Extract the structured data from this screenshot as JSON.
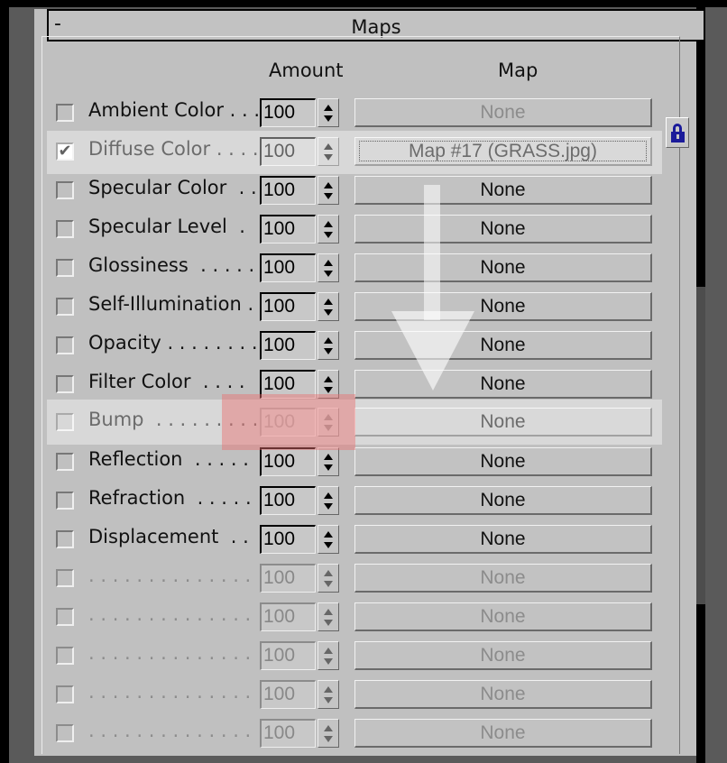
{
  "rollout": {
    "title": "Maps",
    "collapse_symbol": "-"
  },
  "columns": {
    "amount": "Amount",
    "map": "Map"
  },
  "rows": [
    {
      "label": "Ambient Color . . .",
      "checked": false,
      "enabled": true,
      "amount": "100",
      "map": "None",
      "map_enabled": false
    },
    {
      "label": "Diffuse Color . . . .",
      "checked": true,
      "enabled": true,
      "amount": "100",
      "map": "Map #17 (GRASS.jpg)",
      "map_enabled": true
    },
    {
      "label": "Specular Color  . .",
      "checked": false,
      "enabled": true,
      "amount": "100",
      "map": "None",
      "map_enabled": true
    },
    {
      "label": "Specular Level  .",
      "checked": false,
      "enabled": true,
      "amount": "100",
      "map": "None",
      "map_enabled": true
    },
    {
      "label": "Glossiness  . . . . .",
      "checked": false,
      "enabled": true,
      "amount": "100",
      "map": "None",
      "map_enabled": true
    },
    {
      "label": "Self-Illumination .",
      "checked": false,
      "enabled": true,
      "amount": "100",
      "map": "None",
      "map_enabled": true
    },
    {
      "label": "Opacity . . . . . . . .",
      "checked": false,
      "enabled": true,
      "amount": "100",
      "map": "None",
      "map_enabled": true
    },
    {
      "label": "Filter Color  . . . .",
      "checked": false,
      "enabled": true,
      "amount": "100",
      "map": "None",
      "map_enabled": true
    },
    {
      "label": "Bump  . . . . . . . . .",
      "checked": false,
      "enabled": true,
      "amount": "100",
      "map": "None",
      "map_enabled": true,
      "amount_disabled": true
    },
    {
      "label": "Reflection  . . . . .",
      "checked": false,
      "enabled": true,
      "amount": "100",
      "map": "None",
      "map_enabled": true
    },
    {
      "label": "Refraction  . . . . .",
      "checked": false,
      "enabled": true,
      "amount": "100",
      "map": "None",
      "map_enabled": true
    },
    {
      "label": "Displacement  . .",
      "checked": false,
      "enabled": true,
      "amount": "100",
      "map": "None",
      "map_enabled": true
    },
    {
      "label": ". . . . . . . . . . . . . .",
      "checked": false,
      "enabled": false,
      "amount": "100",
      "map": "None",
      "map_enabled": false
    },
    {
      "label": ". . . . . . . . . . . . . .",
      "checked": false,
      "enabled": false,
      "amount": "100",
      "map": "None",
      "map_enabled": false
    },
    {
      "label": ". . . . . . . . . . . . . .",
      "checked": false,
      "enabled": false,
      "amount": "100",
      "map": "None",
      "map_enabled": false
    },
    {
      "label": ". . . . . . . . . . . . . .",
      "checked": false,
      "enabled": false,
      "amount": "100",
      "map": "None",
      "map_enabled": false
    },
    {
      "label": ". . . . . . . . . . . . . .",
      "checked": false,
      "enabled": false,
      "amount": "100",
      "map": "None",
      "map_enabled": false
    }
  ],
  "icons": {
    "lock": "lock-icon",
    "arrow": "arrow-down-icon"
  },
  "colors": {
    "panel_bg": "#c0c0c0",
    "lock": "#1b1b9a",
    "highlight_red": "#eb6e6e"
  }
}
